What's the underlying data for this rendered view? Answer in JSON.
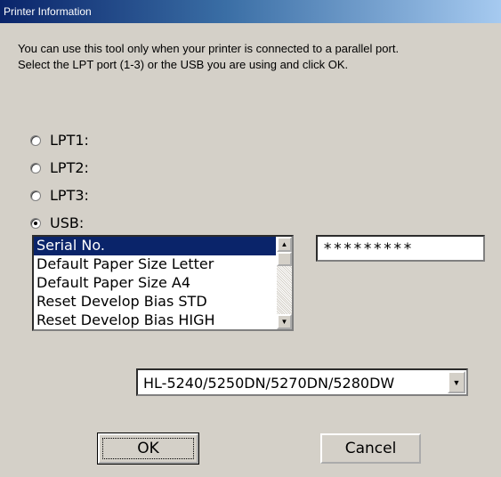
{
  "window": {
    "title": "Printer Information"
  },
  "instructions": [
    "You can use this tool only when your printer is connected to a parallel port.",
    "Select the LPT port (1-3) or the USB you are using and click OK."
  ],
  "ports": [
    {
      "label": "LPT1:",
      "checked": false
    },
    {
      "label": "LPT2:",
      "checked": false
    },
    {
      "label": "LPT3:",
      "checked": false
    },
    {
      "label": "USB:",
      "checked": true
    }
  ],
  "function_list": {
    "items": [
      "Serial No.",
      "Default Paper Size Letter",
      "Default Paper Size A4",
      "Reset Develop Bias STD",
      "Reset Develop Bias HIGH"
    ],
    "selected": "Serial No."
  },
  "serial_field": {
    "value": "*********"
  },
  "model_select": {
    "value": "HL-5240/5250DN/5270DN/5280DW"
  },
  "buttons": {
    "ok": "OK",
    "cancel": "Cancel"
  }
}
